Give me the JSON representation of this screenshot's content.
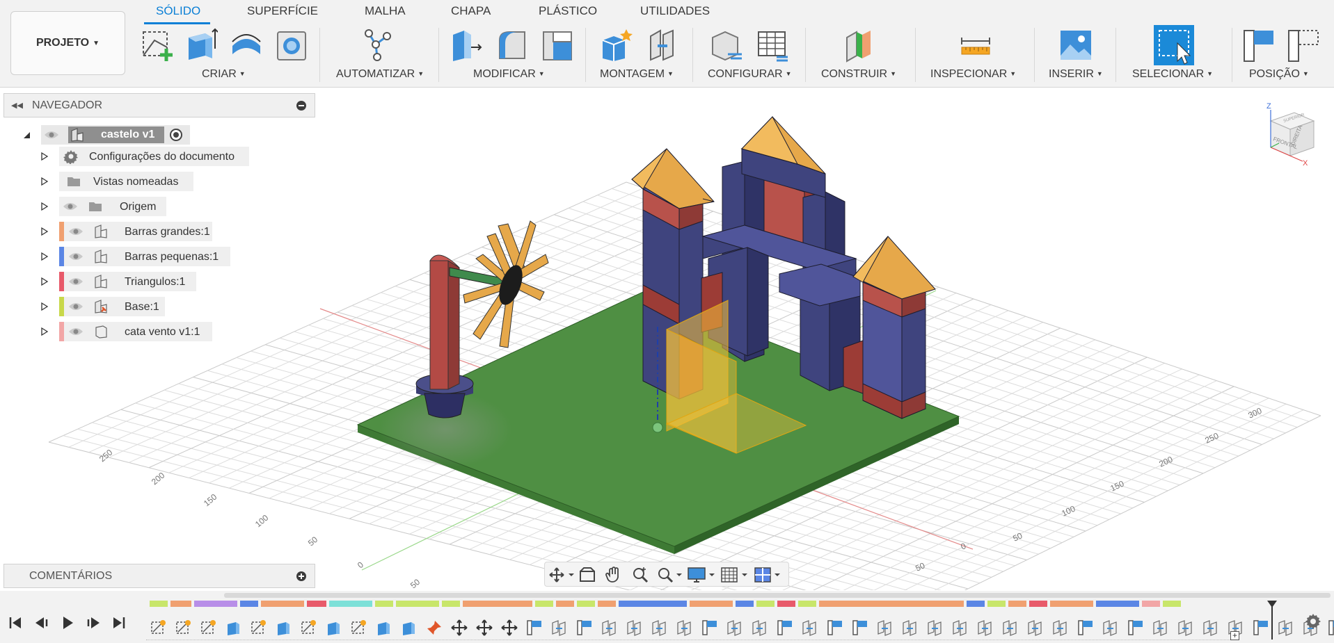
{
  "toolbar": {
    "project_label": "PROJETO",
    "tabs": [
      "SÓLIDO",
      "SUPERFÍCIE",
      "MALHA",
      "CHAPA",
      "PLÁSTICO",
      "UTILIDADES"
    ],
    "groups": {
      "criar": "CRIAR",
      "automatizar": "AUTOMATIZAR",
      "modificar": "MODIFICAR",
      "montagem": "MONTAGEM",
      "configurar": "CONFIGURAR",
      "construir": "CONSTRUIR",
      "inspecionar": "INSPECIONAR",
      "inserir": "INSERIR",
      "selecionar": "SELECIONAR",
      "posicao": "POSIÇÃO"
    },
    "accent_color": "#0a7fd6"
  },
  "browser": {
    "title": "NAVEGADOR",
    "root": "castelo v1",
    "items": [
      {
        "label": "Configurações do documento",
        "icon": "gear-icon",
        "color": null
      },
      {
        "label": "Vistas nomeadas",
        "icon": "folder-icon",
        "color": null
      },
      {
        "label": "Origem",
        "icon": "folder-icon",
        "color": null
      },
      {
        "label": "Barras grandes:1",
        "icon": "component-icon",
        "color": "#f0a070"
      },
      {
        "label": "Barras pequenas:1",
        "icon": "component-icon",
        "color": "#5b86e5"
      },
      {
        "label": "Triangulos:1",
        "icon": "component-icon",
        "color": "#e85a6a"
      },
      {
        "label": "Base:1",
        "icon": "component-pinned-icon",
        "color": "#c8d84a"
      },
      {
        "label": "cata vento v1:1",
        "icon": "linked-component-icon",
        "color": "#f2a6a6"
      }
    ]
  },
  "comments": {
    "title": "COMENTÁRIOS"
  },
  "viewcube": {
    "front": "FRONTAL",
    "right": "DIREITA",
    "top": "SUPERIOR",
    "axis_z": "Z",
    "axis_x": "X"
  },
  "grid_labels": {
    "right": [
      "300",
      "250",
      "200",
      "150",
      "100",
      "50",
      "0"
    ],
    "left": [
      "250",
      "200",
      "150",
      "100",
      "50",
      "0",
      "50"
    ],
    "bottom": "50"
  },
  "timeline": {
    "group_colors": [
      "#c8e66a",
      "#f0a070",
      "#b88ee8",
      "#5b86e5",
      "#f0a070",
      "#e85a6a",
      "#7de0d8",
      "#c8e66a",
      "#c8e66a",
      "#c8e66a",
      "#f0a070",
      "#c8e66a",
      "#f0a070",
      "#c8e66a",
      "#f0a070",
      "#5b86e5",
      "#f0a070",
      "#5b86e5",
      "#c8e66a",
      "#e85a6a",
      "#c8e66a",
      "#f0a070",
      "#5b86e5",
      "#c8e66a",
      "#f0a070",
      "#e85a6a",
      "#f0a070",
      "#5b86e5",
      "#f2a6a6",
      "#c8e66a"
    ]
  }
}
